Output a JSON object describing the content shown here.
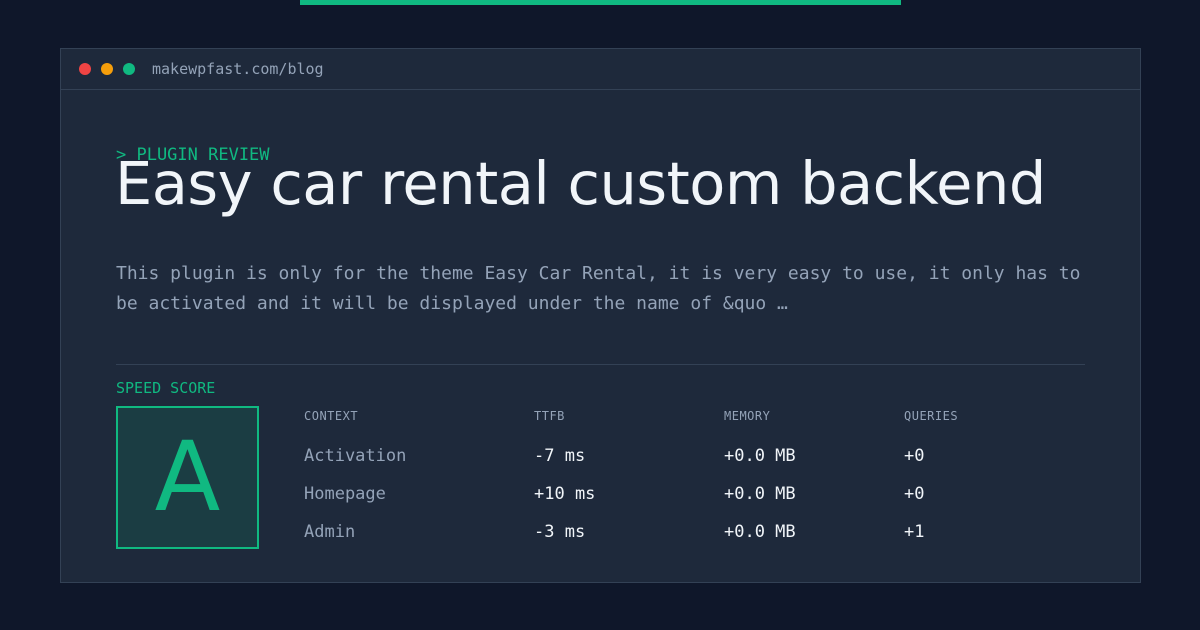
{
  "accent_color": "#10b981",
  "window": {
    "url": "makewpfast.com/blog"
  },
  "article": {
    "kicker": "> PLUGIN REVIEW",
    "title": "Easy car rental custom backend",
    "description": "This plugin is only for the theme Easy Car Rental, it is very easy to use, it only has to be activated and it will be displayed under the name of &quo …"
  },
  "speed": {
    "label": "SPEED SCORE",
    "grade": "A",
    "headers": [
      "CONTEXT",
      "TTFB",
      "MEMORY",
      "QUERIES"
    ],
    "rows": [
      {
        "context": "Activation",
        "ttfb": "-7 ms",
        "memory": "+0.0 MB",
        "queries": "+0"
      },
      {
        "context": "Homepage",
        "ttfb": "+10 ms",
        "memory": "+0.0 MB",
        "queries": "+0"
      },
      {
        "context": "Admin",
        "ttfb": "-3 ms",
        "memory": "+0.0 MB",
        "queries": "+1"
      }
    ]
  }
}
